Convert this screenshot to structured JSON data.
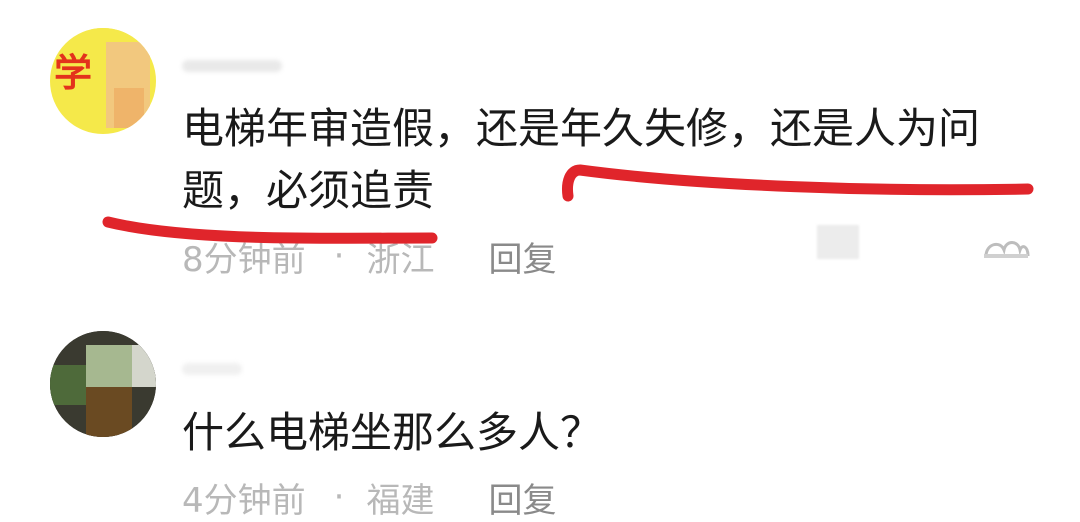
{
  "comments": [
    {
      "text": "电梯年审造假，还是年久失修，还是人为问题，必须追责",
      "time": "8分钟前",
      "separator": "·",
      "location": "浙江",
      "reply_label": "回复",
      "avatar_glyph": "学"
    },
    {
      "text": "什么电梯坐那么多人？",
      "time": "4分钟前",
      "separator": "·",
      "location": "福建",
      "reply_label": "回复"
    }
  ],
  "colors": {
    "annotation": "#e0252b",
    "meta_text": "#b8b8b8",
    "reply_text": "#8a8a8a",
    "body_text": "#1a1a1a"
  },
  "icons": {
    "more": "more-options-icon",
    "like": "like-icon"
  }
}
